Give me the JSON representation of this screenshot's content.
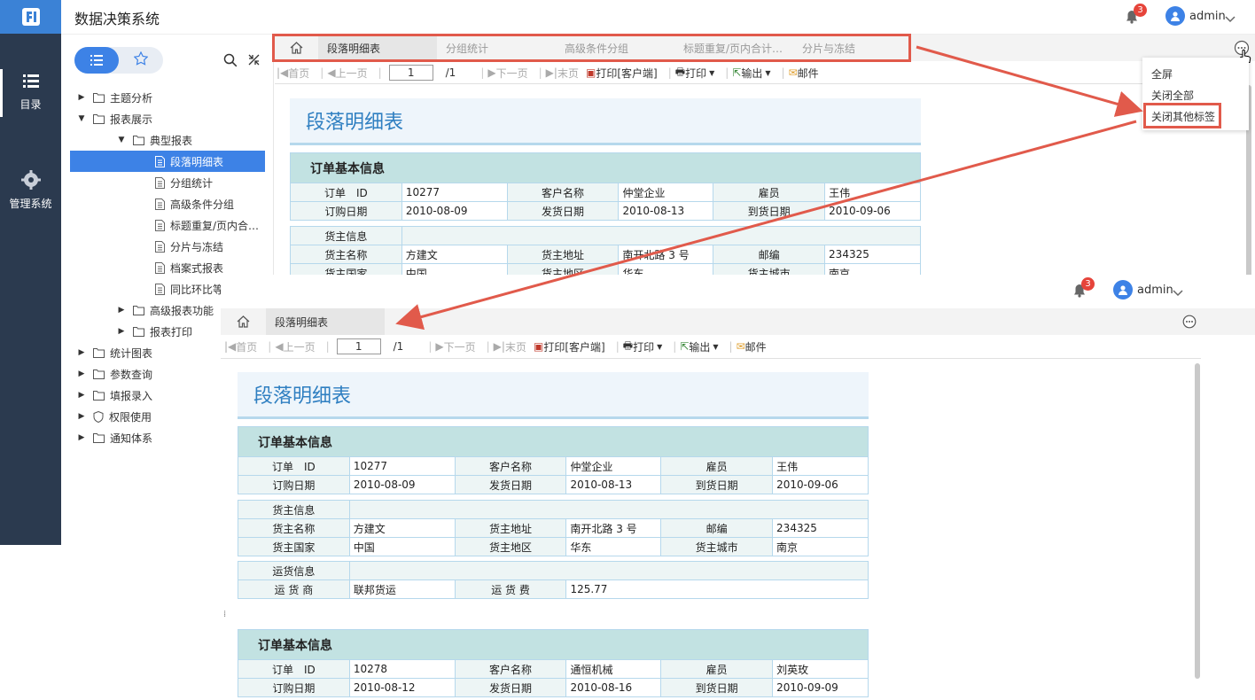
{
  "app": {
    "title": "数据决策系统"
  },
  "leftnav": {
    "items": [
      {
        "label": "目录",
        "icon": "list-icon"
      },
      {
        "label": "管理系统",
        "icon": "gear-icon"
      }
    ]
  },
  "header": {
    "notification_count": "3",
    "user": "admin"
  },
  "tree": {
    "items": [
      {
        "label": "主题分析"
      },
      {
        "label": "报表展示"
      },
      {
        "label": "典型报表"
      },
      {
        "label": "段落明细表"
      },
      {
        "label": "分组统计"
      },
      {
        "label": "高级条件分组"
      },
      {
        "label": "标题重复/页内合…"
      },
      {
        "label": "分片与冻结"
      },
      {
        "label": "档案式报表"
      },
      {
        "label": "同比环比等"
      },
      {
        "label": "高级报表功能"
      },
      {
        "label": "报表打印"
      },
      {
        "label": "统计图表"
      },
      {
        "label": "参数查询"
      },
      {
        "label": "填报录入"
      },
      {
        "label": "权限使用"
      },
      {
        "label": "通知体系"
      }
    ]
  },
  "tabs": [
    {
      "label": "段落明细表"
    },
    {
      "label": "分组统计"
    },
    {
      "label": "高级条件分组"
    },
    {
      "label": "标题重复/页内合计…"
    },
    {
      "label": "分片与冻结"
    }
  ],
  "toolbar": {
    "first": "首页",
    "prev": "上一页",
    "page": "1",
    "total": "/1",
    "next": "下一页",
    "last": "末页",
    "print_client": "打印[客户端]",
    "print": "打印",
    "export": "输出",
    "mail": "邮件"
  },
  "menu": {
    "items": [
      "全屏",
      "关闭全部",
      "关闭其他标签"
    ]
  },
  "report": {
    "title": "段落明细表",
    "section_title": "订单基本信息",
    "labels": {
      "order_id": "订单　ID",
      "customer": "客户名称",
      "employee": "雇员",
      "order_date": "订购日期",
      "ship_date": "发货日期",
      "arrive_date": "到货日期",
      "shipper_info": "货主信息",
      "shipper_name": "货主名称",
      "shipper_addr": "货主地址",
      "zip": "邮编",
      "shipper_country": "货主国家",
      "shipper_region": "货主地区",
      "shipper_city": "货主城市",
      "carrier_info": "运货信息",
      "carrier": "运 货 商",
      "freight": "运 货 费"
    },
    "order1": {
      "order_id": "10277",
      "customer": "仲堂企业",
      "employee": "王伟",
      "order_date": "2010-08-09",
      "ship_date": "2010-08-13",
      "arrive_date": "2010-09-06",
      "shipper_name": "方建文",
      "shipper_addr": "南开北路 3 号",
      "zip": "234325",
      "shipper_country": "中国",
      "shipper_region": "华东",
      "shipper_city": "南京",
      "carrier": "联邦货运",
      "freight": "125.77"
    },
    "order2": {
      "order_id": "10278",
      "customer": "通恒机械",
      "employee": "刘英玫",
      "order_date": "2010-08-12",
      "ship_date": "2010-08-16",
      "arrive_date": "2010-09-09"
    }
  },
  "colors": {
    "accent": "#3d82e6",
    "nav": "#2b3a4f",
    "annotation": "#e15a4b"
  }
}
